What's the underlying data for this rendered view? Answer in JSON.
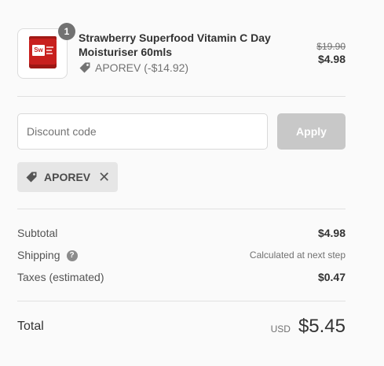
{
  "product": {
    "quantity": "1",
    "title": "Strawberry Superfood Vitamin C Day Moisturiser 60mls",
    "discount_text": "APOREV (-$14.92)",
    "original_price": "$19.90",
    "final_price": "$4.98",
    "thumb_logo": "Sw"
  },
  "discount": {
    "placeholder": "Discount code",
    "apply_label": "Apply",
    "applied_code": "APOREV"
  },
  "totals": {
    "subtotal_label": "Subtotal",
    "subtotal_value": "$4.98",
    "shipping_label": "Shipping",
    "shipping_value": "Calculated at next step",
    "taxes_label": "Taxes (estimated)",
    "taxes_value": "$0.47",
    "total_label": "Total",
    "currency": "USD",
    "total_value": "$5.45"
  },
  "icons": {
    "tag": "tag-icon",
    "close": "close-icon",
    "help": "question-circle-icon"
  },
  "colors": {
    "badge": "#727272",
    "apply_disabled": "#c8c8c8",
    "chip_bg": "#e6e6e6",
    "product_red": "#c8201e"
  }
}
